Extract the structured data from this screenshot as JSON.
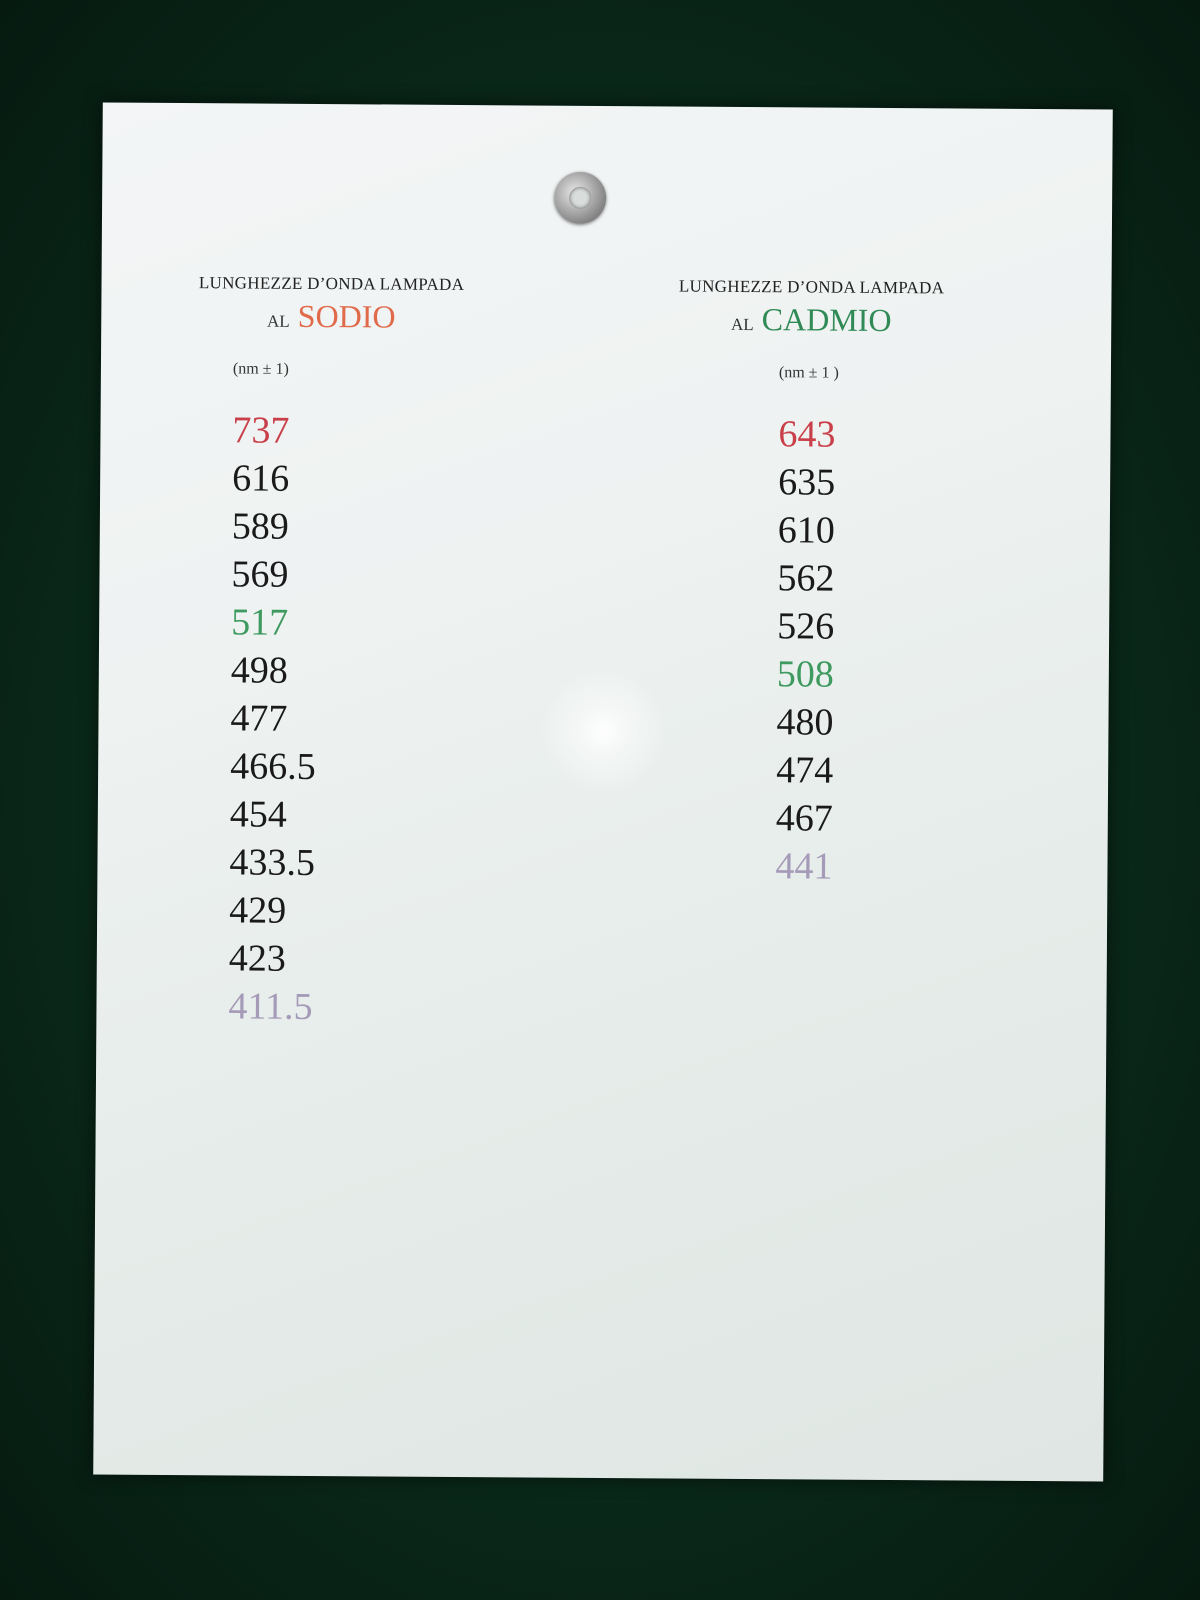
{
  "sodio": {
    "heading": "LUNGHEZZE D’ONDA LAMPADA",
    "al": "AL",
    "element": "SODIO",
    "unit": "(nm ± 1)",
    "values": [
      {
        "v": "737",
        "color": "red"
      },
      {
        "v": "616",
        "color": "black"
      },
      {
        "v": "589",
        "color": "black"
      },
      {
        "v": "569",
        "color": "black"
      },
      {
        "v": "517",
        "color": "green"
      },
      {
        "v": "498",
        "color": "black"
      },
      {
        "v": "477",
        "color": "black"
      },
      {
        "v": "466.5",
        "color": "black"
      },
      {
        "v": "454",
        "color": "black"
      },
      {
        "v": "433.5",
        "color": "black"
      },
      {
        "v": "429",
        "color": "black"
      },
      {
        "v": "423",
        "color": "black"
      },
      {
        "v": "411.5",
        "color": "violet"
      }
    ]
  },
  "cadmio": {
    "heading": "LUNGHEZZE D’ONDA LAMPADA",
    "al": "AL",
    "element": "CADMIO",
    "unit": "(nm ± 1 )",
    "values": [
      {
        "v": "643",
        "color": "red"
      },
      {
        "v": "635",
        "color": "black"
      },
      {
        "v": "610",
        "color": "black"
      },
      {
        "v": "562",
        "color": "black"
      },
      {
        "v": "526",
        "color": "black"
      },
      {
        "v": "508",
        "color": "green"
      },
      {
        "v": "480",
        "color": "black"
      },
      {
        "v": "474",
        "color": "black"
      },
      {
        "v": "467",
        "color": "black"
      },
      {
        "v": "441",
        "color": "violet"
      }
    ]
  },
  "colors": {
    "red": "#c9404a",
    "green": "#3f9a60",
    "violet": "#a59ab8",
    "black": "#1a1a1a",
    "sodio_title": "#e06a4a",
    "cadmio_title": "#2f8a55",
    "board": "#0b2a1c",
    "paper": "#eef2f1"
  }
}
